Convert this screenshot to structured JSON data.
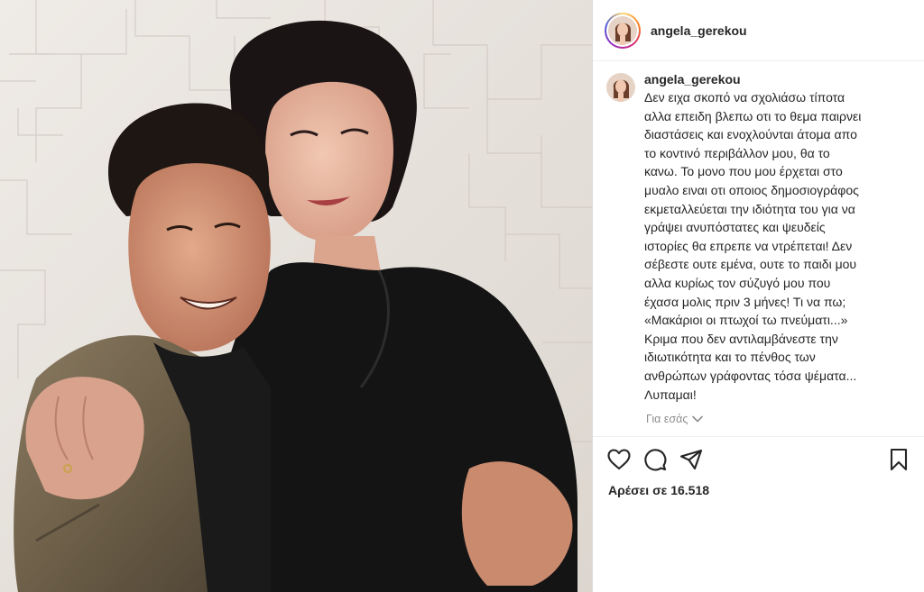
{
  "post": {
    "username": "angela_gerekou",
    "caption_lines": [
      "Δεν ειχα σκοπό να σχολιάσω τίποτα",
      "αλλα επειδη βλεπω οτι το θεμα παιρνει",
      "διαστάσεις και ενοχλούνται άτομα απο",
      "το κοντινό περιβάλλον μου, θα το",
      "κανω. Το μονο που μου έρχεται στο",
      "μυαλο ειναι οτι οποιος δημοσιογράφος",
      "εκμεταλλεύεται την ιδιότητα του για να",
      "γράψει ανυπόστατες και ψευδείς",
      "ιστορίες θα επρεπε να ντρέπεται! Δεν",
      "σέβεστε ουτε εμένα, ουτε το παιδι μου",
      "αλλα κυρίως τον σύζυγό μου που",
      "έχασα μολις πριν 3 μήνες! Τι να πω;",
      "«Μακάριοι οι πτωχοί τω πνεύματι...»",
      "Κριμα που δεν αντιλαμβάνεστε την",
      "ιδιωτικότητα και το πένθος των",
      "ανθρώπων γράφοντας τόσα ψέματα...",
      "Λυπαμαι!"
    ],
    "translate_label": "Για εσάς",
    "likes_label": "Αρέσει σε 16.518"
  },
  "icons": {
    "like": "heart-icon",
    "comment": "comment-icon",
    "share": "share-icon",
    "save": "bookmark-icon",
    "translate_chevron": "chevron-down-icon"
  },
  "colors": {
    "text": "#262626",
    "muted": "#8e8e8e",
    "divider": "#efefef"
  }
}
